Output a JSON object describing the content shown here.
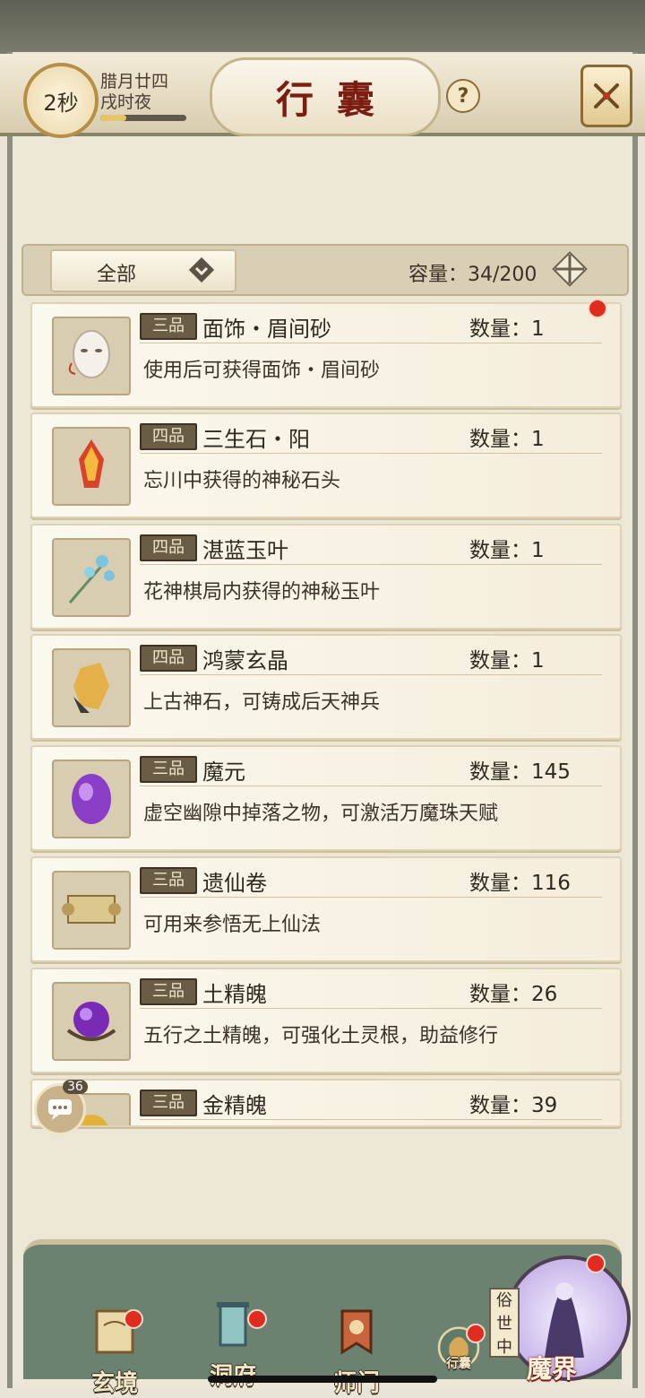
{
  "header": {
    "timer": "2秒",
    "date_line1": "腊月廿四",
    "date_line2": "戌时夜",
    "progress": 0.3,
    "title": "行囊",
    "help": "?"
  },
  "filter": {
    "selected": "全部",
    "capacity_label": "容量：34/200"
  },
  "items": [
    {
      "grade": "三品",
      "name": "面饰・眉间砂",
      "qty": "数量：1",
      "desc": "使用后可获得面饰・眉间砂",
      "icon": "mask-icon",
      "new": true
    },
    {
      "grade": "四品",
      "name": "三生石・阳",
      "qty": "数量：1",
      "desc": "忘川中获得的神秘石头",
      "icon": "fire-crystal-icon"
    },
    {
      "grade": "四品",
      "name": "湛蓝玉叶",
      "qty": "数量：1",
      "desc": "花神棋局内获得的神秘玉叶",
      "icon": "blue-flower-icon"
    },
    {
      "grade": "四品",
      "name": "鸿蒙玄晶",
      "qty": "数量：1",
      "desc": "上古神石，可铸成后天神兵",
      "icon": "gold-crystal-icon"
    },
    {
      "grade": "三品",
      "name": "魔元",
      "qty": "数量：145",
      "desc": "虚空幽隙中掉落之物，可激活万魔珠天赋",
      "icon": "purple-gem-icon"
    },
    {
      "grade": "三品",
      "name": "遗仙卷",
      "qty": "数量：116",
      "desc": "可用来参悟无上仙法",
      "icon": "scroll-icon"
    },
    {
      "grade": "三品",
      "name": "土精魄",
      "qty": "数量：26",
      "desc": "五行之土精魄，可强化土灵根，助益修行",
      "icon": "purple-orb-icon"
    },
    {
      "grade": "三品",
      "name": "金精魄",
      "qty": "数量：39",
      "desc": "",
      "icon": "gold-orb-icon"
    }
  ],
  "chat": {
    "count": "36"
  },
  "nav": {
    "items": [
      {
        "label": "玄境",
        "icon": "scroll-map-icon"
      },
      {
        "label": "洞府",
        "icon": "lantern-icon"
      },
      {
        "label": "师门",
        "icon": "banner-icon"
      },
      {
        "label": "行囊",
        "icon": "bag-icon"
      }
    ],
    "demon_tag": [
      "俗",
      "世",
      "中"
    ],
    "demon_label": "魔界"
  },
  "colors": {
    "accent_red": "#7c1d12",
    "badge_red": "#e02b1f",
    "panel_green": "#6c8270"
  }
}
